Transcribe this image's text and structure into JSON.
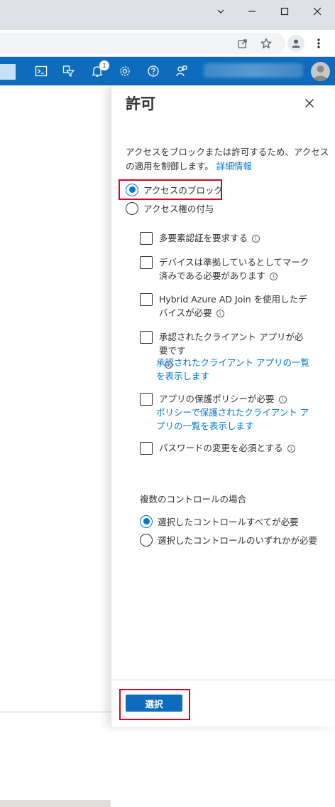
{
  "blade": {
    "title": "許可",
    "description": "アクセスをブロックまたは許可するため、アクセスの適用を制御します。",
    "description_link": "詳細情報",
    "access_options": [
      {
        "label": "アクセスのブロック",
        "selected": true
      },
      {
        "label": "アクセス権の付与",
        "selected": false
      }
    ],
    "controls": [
      {
        "label": "多要素認証を要求する",
        "checked": false
      },
      {
        "label": "デバイスは準拠しているとしてマーク済みである必要があります",
        "checked": false
      },
      {
        "label": "Hybrid Azure AD Join を使用したデバイスが必要",
        "checked": false
      },
      {
        "label": "承認されたクライアント アプリが必要です",
        "checked": false,
        "link": "承認されたクライアント アプリの一覧を表示します"
      },
      {
        "label": "アプリの保護ポリシーが必要",
        "checked": false,
        "link": "ポリシーで保護されたクライアント アプリの一覧を表示します"
      },
      {
        "label": "パスワードの変更を必須とする",
        "checked": false
      }
    ],
    "multi_control_label": "複数のコントロールの場合",
    "multi_control_options": [
      {
        "label": "選択したコントロールすべてが必要",
        "selected": true
      },
      {
        "label": "選択したコントロールのいずれかが必要",
        "selected": false
      }
    ],
    "select_button": "選択"
  },
  "topbar": {
    "notification_count": "1",
    "icons": [
      "cloud-shell-icon",
      "directory-filter-icon",
      "notifications-icon",
      "settings-icon",
      "help-icon",
      "feedback-icon"
    ]
  },
  "colors": {
    "accent": "#0078d4",
    "azure_bar": "#0f6cbd",
    "highlight": "#e3001b"
  }
}
